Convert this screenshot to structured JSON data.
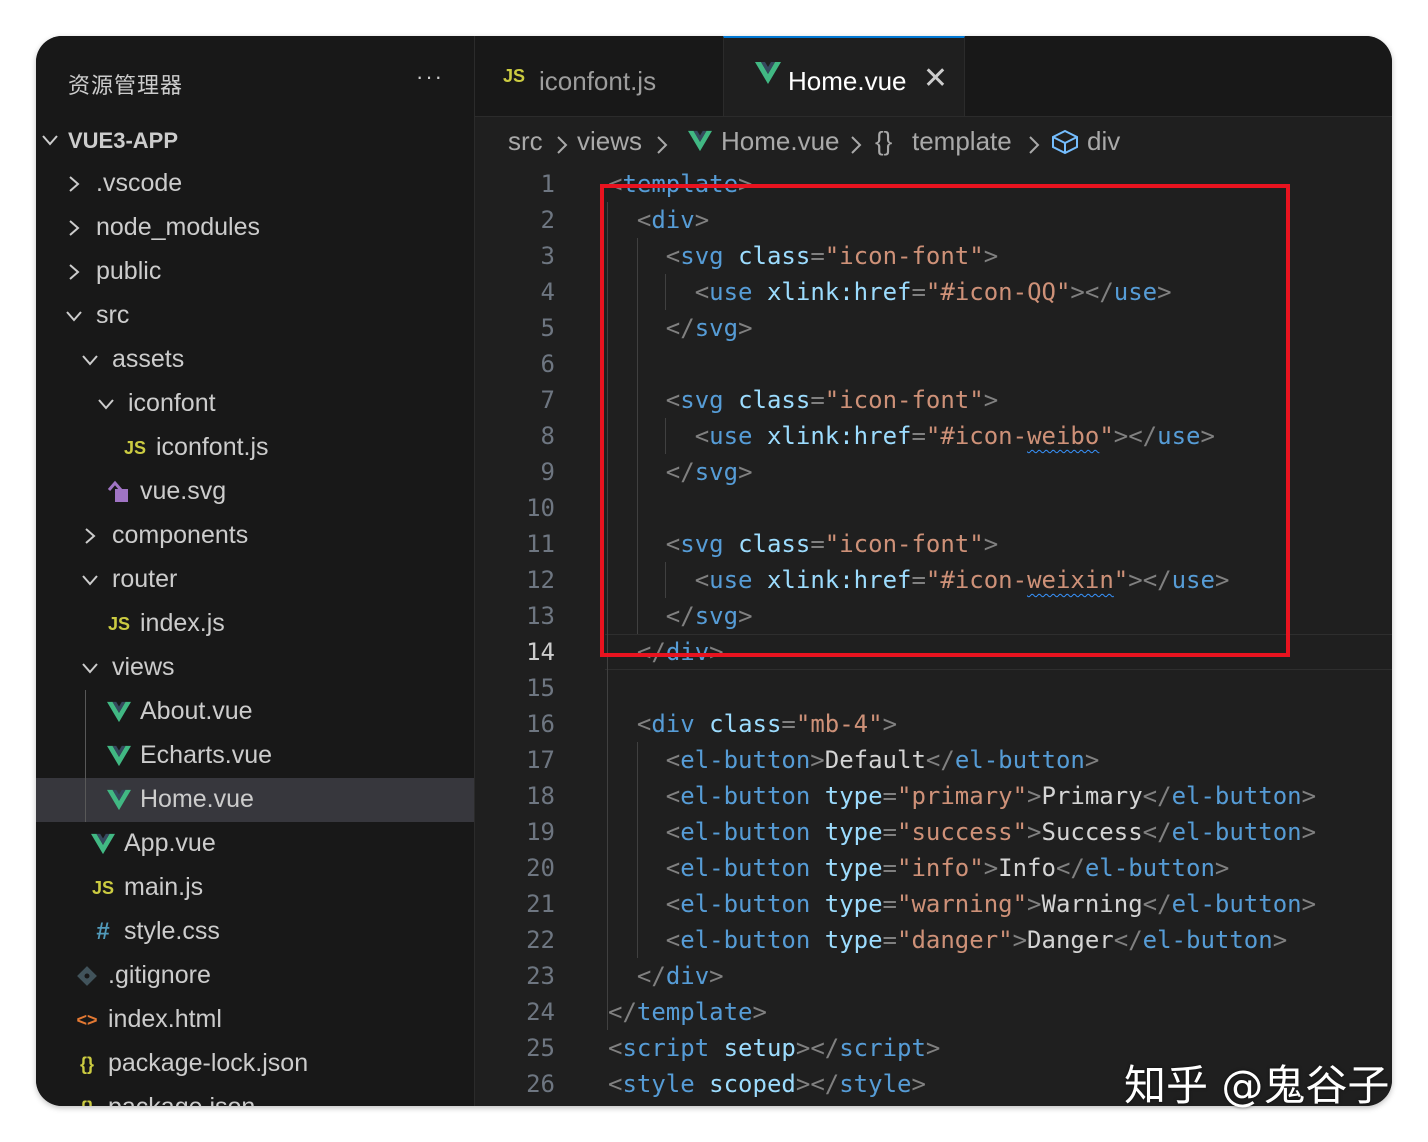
{
  "explorer": {
    "title": "资源管理器",
    "more": "···",
    "items": [
      {
        "label": "VUE3-APP",
        "type": "root",
        "expanded": true
      },
      {
        "label": ".vscode",
        "type": "folder",
        "expanded": false
      },
      {
        "label": "node_modules",
        "type": "folder",
        "expanded": false
      },
      {
        "label": "public",
        "type": "folder",
        "expanded": false
      },
      {
        "label": "src",
        "type": "folder",
        "expanded": true
      },
      {
        "label": "assets",
        "type": "folder",
        "expanded": true
      },
      {
        "label": "iconfont",
        "type": "folder",
        "expanded": true
      },
      {
        "label": "iconfont.js",
        "type": "js"
      },
      {
        "label": "vue.svg",
        "type": "svg"
      },
      {
        "label": "components",
        "type": "folder",
        "expanded": false
      },
      {
        "label": "router",
        "type": "folder",
        "expanded": true
      },
      {
        "label": "index.js",
        "type": "js"
      },
      {
        "label": "views",
        "type": "folder",
        "expanded": true
      },
      {
        "label": "About.vue",
        "type": "vue"
      },
      {
        "label": "Echarts.vue",
        "type": "vue"
      },
      {
        "label": "Home.vue",
        "type": "vue",
        "selected": true
      },
      {
        "label": "App.vue",
        "type": "vue"
      },
      {
        "label": "main.js",
        "type": "js"
      },
      {
        "label": "style.css",
        "type": "css"
      },
      {
        "label": ".gitignore",
        "type": "git"
      },
      {
        "label": "index.html",
        "type": "html"
      },
      {
        "label": "package-lock.json",
        "type": "json"
      },
      {
        "label": "package.json",
        "type": "json"
      }
    ]
  },
  "icons": {
    "js": "JS",
    "css": "#",
    "json": "{}",
    "html": "<>",
    "braces": "{}"
  },
  "tabs": [
    {
      "label": "iconfont.js",
      "icon": "js-file-icon",
      "active": false
    },
    {
      "label": "Home.vue",
      "icon": "vue-file-icon",
      "active": true,
      "close": "✕"
    }
  ],
  "breadcrumb": {
    "src": "src",
    "views": "views",
    "file": "Home.vue",
    "template": "template",
    "div": "div"
  },
  "editor": {
    "active_line": 14,
    "line_numbers": [
      "1",
      "2",
      "3",
      "4",
      "5",
      "6",
      "7",
      "8",
      "9",
      "10",
      "11",
      "12",
      "13",
      "14",
      "15",
      "16",
      "17",
      "18",
      "19",
      "20",
      "21",
      "22",
      "23",
      "24",
      "25",
      "26"
    ],
    "tokens": {
      "template": "template",
      "div": "div",
      "svg": "svg",
      "use": "use",
      "el_button": "el-button",
      "script": "script",
      "style": "style",
      "class_attr": "class",
      "xlink_attr": "xlink:href",
      "type_attr": "type",
      "setup": "setup",
      "scoped": "scoped",
      "icon_font": "\"icon-font\"",
      "icon_qq": "\"#icon-QQ\"",
      "icon_weibo_pre": "\"#icon-",
      "weibo": "weibo",
      "weixin": "weixin",
      "mb4": "\"mb-4\"",
      "primary": "\"primary\"",
      "success": "\"success\"",
      "info": "\"info\"",
      "warning": "\"warning\"",
      "danger": "\"danger\"",
      "txt_default": "Default",
      "txt_primary": "Primary",
      "txt_success": "Success",
      "txt_info": "Info",
      "txt_warning": "Warning",
      "txt_danger": "Danger"
    }
  },
  "colors": {
    "highlight": "#e8131f",
    "vue_green": "#41b883",
    "js_yellow": "#cbcb41",
    "css_blue": "#519aba",
    "accent": "#0078d4"
  },
  "watermark": "知乎 @鬼谷子"
}
